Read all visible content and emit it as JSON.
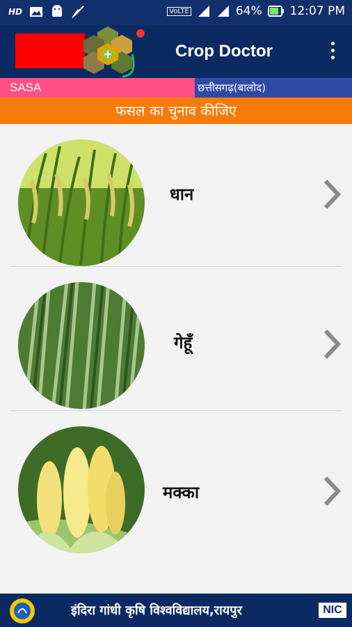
{
  "status_bar": {
    "battery": "64%",
    "time": "12:07 PM",
    "icons": [
      "hd-icon",
      "image-icon",
      "android-icon",
      "mute-icon",
      "volte-icon",
      "signal-icon",
      "battery-icon"
    ]
  },
  "app_bar": {
    "title": "Crop Doctor",
    "menu_icon": "more-vert-icon"
  },
  "info_bar": {
    "left": "SASA",
    "right": "छत्तीसगढ़(बालोद)"
  },
  "heading": "फसल का चुनाव कीजिए",
  "crops": [
    {
      "label": "धान",
      "icon": "rice-image"
    },
    {
      "label": "गेहूँ",
      "icon": "wheat-image"
    },
    {
      "label": "मक्का",
      "icon": "maize-image"
    }
  ],
  "footer": {
    "text": "इंदिरा गांधी कृषि विश्वविद्यालय,रायपुर",
    "nic": "NIC"
  },
  "colors": {
    "status_bar": "#12306b",
    "app_bar": "#0c2a62",
    "info_left": "#ff4f87",
    "info_right": "#2f4aa3",
    "heading": "#f57c0a"
  }
}
